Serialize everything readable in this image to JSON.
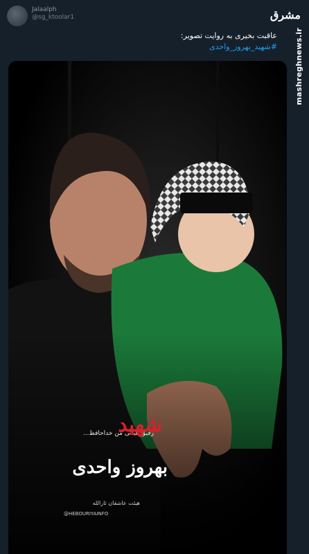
{
  "user": {
    "name": "Jalaalph",
    "handle": "@sg_ktoolar1"
  },
  "logo": {
    "mark": "مشرق",
    "site": "mashreghnews.ir"
  },
  "tweet": {
    "text": "عاقبت بخیری به روایت تصویر:",
    "hashtag": "#شهید_بهروز_واحدی"
  },
  "media": {
    "subtitle": "رفیق هیئتی من خداحافظ...",
    "title_red": "شهید",
    "title_white": "بهروز واحدی",
    "signature": "هیئت عاشقان ثارالله",
    "instagram": "@HEBOURIYAINFO",
    "headband_text": "یا اباعبدالله الحسین"
  },
  "colors": {
    "bg": "#15202b",
    "accent": "#1da1f2",
    "red": "#d9202a",
    "green": "#1b7a3a"
  }
}
